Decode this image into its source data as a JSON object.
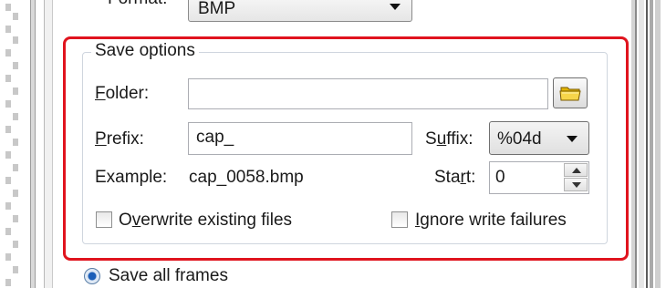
{
  "format": {
    "label": "Format:",
    "value": "BMP"
  },
  "save_options": {
    "title": "Save options",
    "folder": {
      "label": "Folder:",
      "label_underline_char": "F",
      "label_rest": "older:",
      "value": ""
    },
    "prefix": {
      "label": "Prefix:",
      "label_underline_char": "P",
      "label_rest": "refix:",
      "value": "cap_"
    },
    "suffix": {
      "label_pre": "S",
      "label_underline_char": "u",
      "label_rest": "ffix:",
      "value": "%04d"
    },
    "example": {
      "label": "Example:",
      "value": "cap_0058.bmp"
    },
    "start": {
      "label_pre": "Sta",
      "label_underline_char": "r",
      "label_rest": "t:",
      "value": "0"
    },
    "overwrite": {
      "label_pre": "O",
      "label_underline_char": "v",
      "label_rest": "erwrite existing files",
      "checked": false
    },
    "ignore": {
      "label_underline_char": "I",
      "label_rest": "gnore write failures",
      "checked": false
    }
  },
  "save_all_frames": {
    "label": "Save all frames",
    "selected": true
  },
  "colors": {
    "highlight": "#e0141e"
  }
}
